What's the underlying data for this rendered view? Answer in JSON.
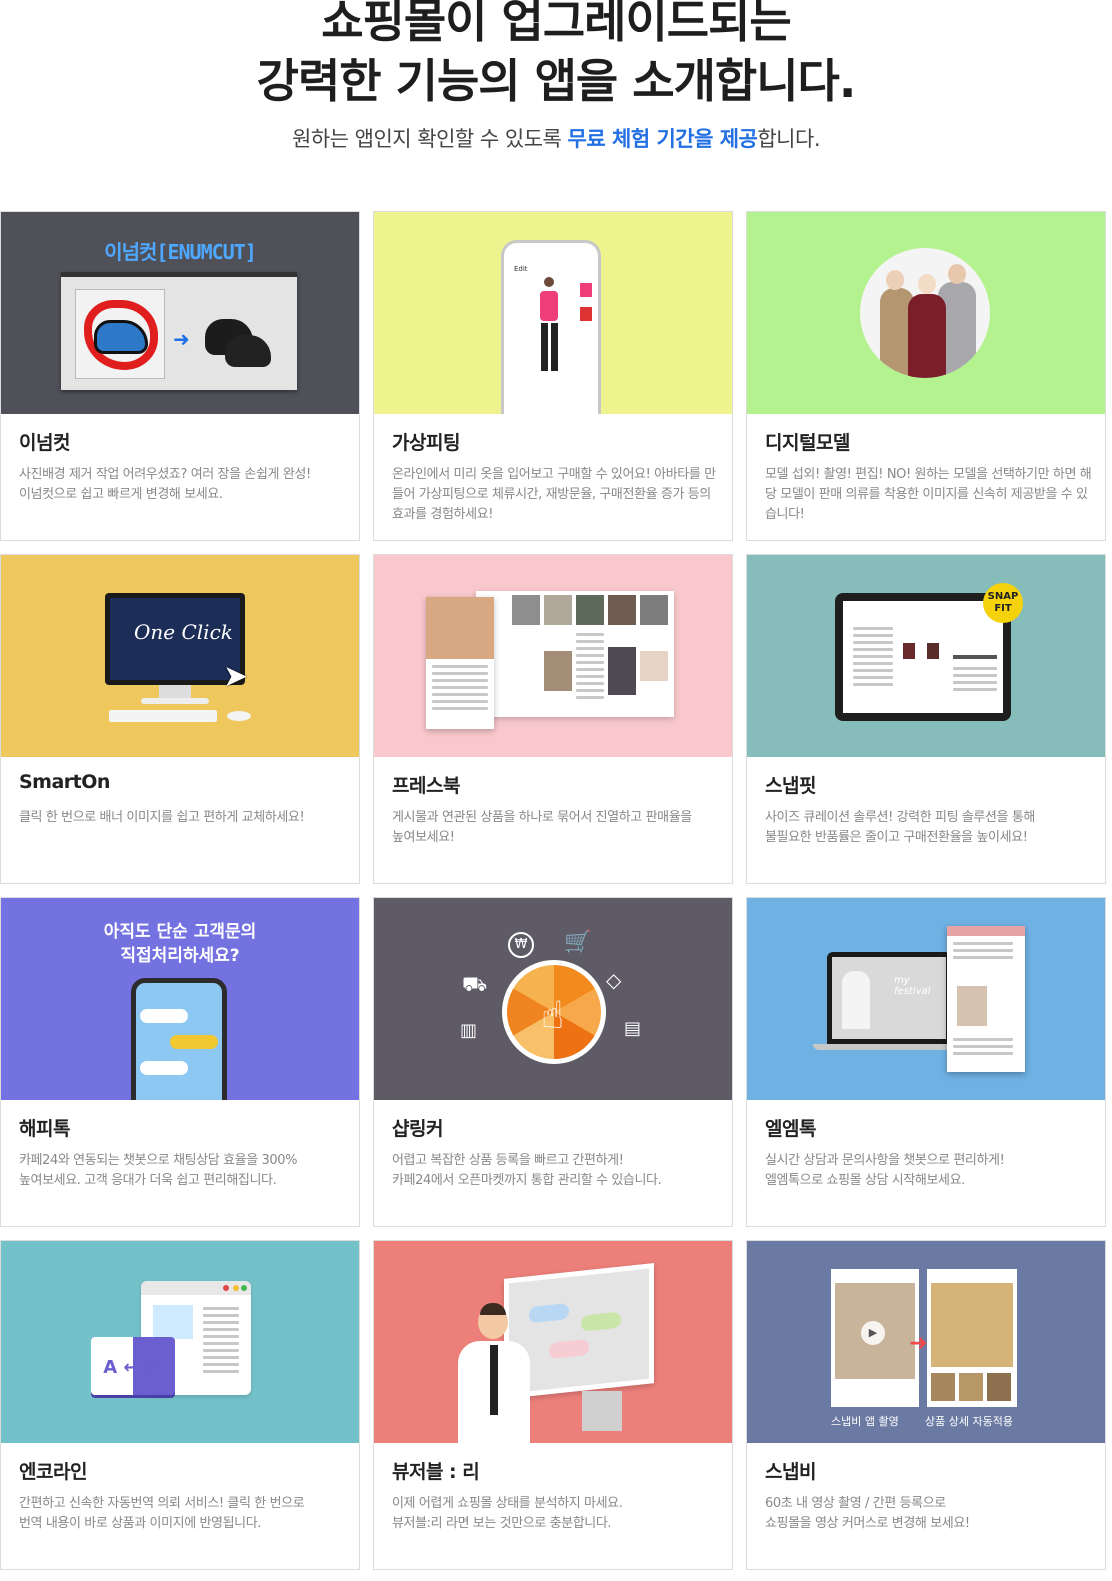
{
  "header": {
    "title_line1": "쇼핑몰이 업그레이드되는",
    "title_line2": "강력한 기능의 앱을 소개합니다.",
    "subtitle_pre": "원하는 앱인지 확인할 수 있도록 ",
    "subtitle_highlight": "무료 체험 기간을 제공",
    "subtitle_post": "합니다."
  },
  "apps": [
    {
      "name": "이넘컷",
      "desc": "사진배경 제거 작업 어려우셨죠? 여러 장을 손쉽게 완성!\n이넘컷으로 쉽고 빠르게 변경해 보세요.",
      "image_caption": "이넘컷[ENUMCUT]",
      "bg": "#4f5058"
    },
    {
      "name": "가상피팅",
      "desc": "온라인에서 미리 옷을 입어보고 구매할 수 있어요! 아바타를 만들어 가상피팅으로 체류시간, 재방문율, 구매전환율 증가 등의 효과를 경험하세요!",
      "image_caption": "Edit",
      "bg": "#eef38d"
    },
    {
      "name": "디지털모델",
      "desc": "모델 섭외! 촬영! 편집! NO! 원하는 모델을 선택하기만 하면 해당 모델이 판매 의류를 착용한 이미지를 신속히 제공받을 수 있습니다!",
      "bg": "#b4f28f"
    },
    {
      "name": "SmartOn",
      "desc": "클릭 한 번으로 배너 이미지를 쉽고 편하게 교체하세요!",
      "image_caption": "One Click",
      "bg": "#eec85d"
    },
    {
      "name": "프레스북",
      "desc": "게시물과 연관된 상품을 하나로 묶어서 진열하고 판매율을\n높여보세요!",
      "bg": "#f8c8cc"
    },
    {
      "name": "스냅핏",
      "desc": "사이즈 큐레이션 솔루션! 강력한 피팅 솔루션을 통해\n불필요한 반품률은 줄이고 구매전환율을 높이세요!",
      "image_caption": "SNAP FIT",
      "bg": "#86bdbb"
    },
    {
      "name": "해피톡",
      "desc": "카페24와 연동되는 챗봇으로 채팅상담 효율을 300%\n높여보세요. 고객 응대가 더욱 쉽고 편리해집니다.",
      "image_caption_line1": "아직도 단순 고객문의",
      "image_caption_line2": "직접처리하세요?",
      "bg": "#7471e0"
    },
    {
      "name": "샵링커",
      "desc": "어렵고 복잡한 상품 등록을 빠르고 간편하게!\n카페24에서 오픈마켓까지 통합 관리할 수 있습니다.",
      "bg": "#5e5a66"
    },
    {
      "name": "엘엠톡",
      "desc": "실시간 상담과 문의사항을 챗봇으로 편리하게!\n엘엠톡으로 쇼핑몰 상담 시작해보세요.",
      "image_caption": "my festival",
      "bg": "#6fb1e3"
    },
    {
      "name": "엔코라인",
      "desc": "간편하고 신속한 자동번역 의뢰 서비스! 클릭 한 번으로\n번역 내용이 바로 상품과 이미지에 반영됩니다.",
      "image_caption": "A ↔ お",
      "bg": "#74c2c9"
    },
    {
      "name": "뷰저블 : 리",
      "desc": "이제 어렵게 쇼핑몰 상태를 분석하지 마세요.\n뷰저블:리 라면 보는 것만으로 충분합니다.",
      "bg": "#ec7f7a"
    },
    {
      "name": "스냅비",
      "desc": "60초 내 영상 촬영 / 간편 등록으로\n쇼핑몰을 영상 커머스로 변경해 보세요!",
      "image_caption_left": "스냅비 앱 촬영",
      "image_caption_right": "상품 상세 자동적용",
      "bg": "#6b7aa3"
    }
  ]
}
